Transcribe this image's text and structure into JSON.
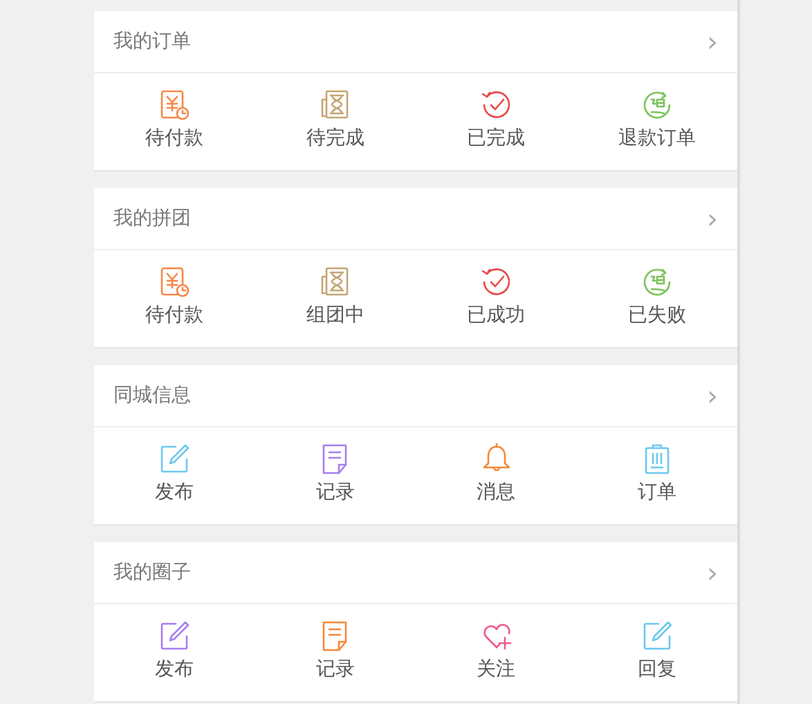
{
  "sections": [
    {
      "title": "我的订单",
      "chevron": "›",
      "items": [
        {
          "label": "待付款",
          "kind": "yuan-clock",
          "color": "#f5884a"
        },
        {
          "label": "待完成",
          "kind": "hourglass",
          "color": "#c5a676"
        },
        {
          "label": "已完成",
          "kind": "check-refresh",
          "color": "#ea4a4a"
        },
        {
          "label": "退款订单",
          "kind": "refund",
          "color": "#7cc35a"
        }
      ]
    },
    {
      "title": "我的拼团",
      "chevron": "›",
      "items": [
        {
          "label": "待付款",
          "kind": "yuan-clock",
          "color": "#f5884a"
        },
        {
          "label": "组团中",
          "kind": "hourglass",
          "color": "#c5a676"
        },
        {
          "label": "已成功",
          "kind": "check-refresh",
          "color": "#ea4a4a"
        },
        {
          "label": "已失败",
          "kind": "refund",
          "color": "#7cc35a"
        }
      ]
    },
    {
      "title": "同城信息",
      "chevron": "›",
      "items": [
        {
          "label": "发布",
          "kind": "pencil",
          "color": "#6cc8ee"
        },
        {
          "label": "记录",
          "kind": "note",
          "color": "#a67ef0"
        },
        {
          "label": "消息",
          "kind": "bell",
          "color": "#f5883a"
        },
        {
          "label": "订单",
          "kind": "clipboard",
          "color": "#6cc8ee"
        }
      ]
    },
    {
      "title": "我的圈子",
      "chevron": "›",
      "items": [
        {
          "label": "发布",
          "kind": "pencil",
          "color": "#a67ef0"
        },
        {
          "label": "记录",
          "kind": "note",
          "color": "#f5883a"
        },
        {
          "label": "关注",
          "kind": "heart-plus",
          "color": "#ee5a8a"
        },
        {
          "label": "回复",
          "kind": "pencil",
          "color": "#6cc8ee"
        }
      ]
    }
  ]
}
